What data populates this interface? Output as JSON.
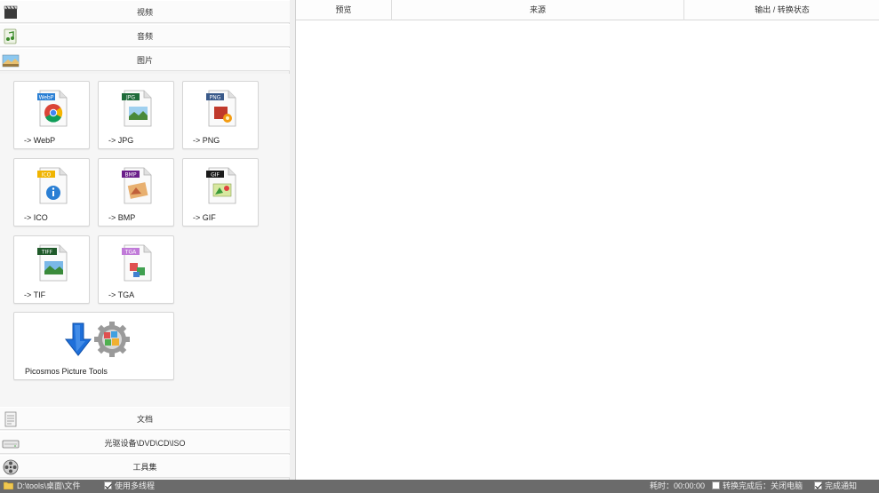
{
  "categories": {
    "video": {
      "label": "视频",
      "icon": "film-icon"
    },
    "audio": {
      "label": "音频",
      "icon": "music-note-icon"
    },
    "image": {
      "label": "图片",
      "icon": "landscape-picture-icon"
    },
    "document": {
      "label": "文档",
      "icon": "document-icon"
    },
    "disc": {
      "label": "光驱设备\\DVD\\CD\\ISO",
      "icon": "disc-drive-icon"
    },
    "tools": {
      "label": "工具集",
      "icon": "film-reel-icon"
    }
  },
  "image_formats": [
    {
      "label": "-> WebP",
      "badge": "WebP",
      "badge_color": "#2a7fd4",
      "icon": "webp-file-icon"
    },
    {
      "label": "-> JPG",
      "badge": "JPG",
      "badge_color": "#1f6b3a",
      "icon": "jpg-file-icon"
    },
    {
      "label": "-> PNG",
      "badge": "PNG",
      "badge_color": "#3a5a8a",
      "icon": "png-file-icon"
    },
    {
      "label": "-> ICO",
      "badge": "ICO",
      "badge_color": "#f0b400",
      "icon": "ico-file-icon"
    },
    {
      "label": "-> BMP",
      "badge": "BMP",
      "badge_color": "#6b1f8a",
      "icon": "bmp-file-icon"
    },
    {
      "label": "-> GIF",
      "badge": "GIF",
      "badge_color": "#1a1a1a",
      "icon": "gif-file-icon"
    },
    {
      "label": "-> TIF",
      "badge": "TIFF",
      "badge_color": "#1f5a2a",
      "icon": "tif-file-icon"
    },
    {
      "label": "-> TGA",
      "badge": "TGA",
      "badge_color": "#c07ad8",
      "icon": "tga-file-icon"
    }
  ],
  "picture_tools": {
    "label": "Picosmos Picture Tools",
    "icon": "picture-tools-icon"
  },
  "table": {
    "columns": [
      "预览",
      "来源",
      "输出 / 转换状态"
    ]
  },
  "status_bar": {
    "output_path": "D:\\tools\\桌面\\文件",
    "multithread_label": "使用多线程",
    "multithread_checked": true,
    "elapsed": "耗时：00:00:00",
    "shutdown_label": "转换完成后：关闭电脑",
    "shutdown_checked": false,
    "notify_label": "完成通知",
    "notify_checked": true
  }
}
